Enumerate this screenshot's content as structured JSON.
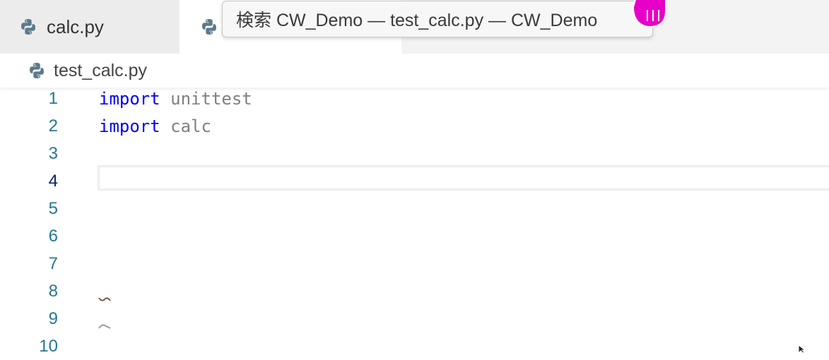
{
  "tabs": [
    {
      "label": "calc.py",
      "icon": "python-icon",
      "active": false
    },
    {
      "label": "test_calc.py",
      "icon": "python-icon",
      "active": true
    }
  ],
  "tooltip": {
    "text": "検索 CW_Demo — test_calc.py — CW_Demo"
  },
  "breadcrumb": {
    "file": "test_calc.py",
    "icon": "python-icon"
  },
  "editor": {
    "current_line": 4,
    "lines": [
      {
        "num": "1",
        "keyword": "import",
        "module": "unittest"
      },
      {
        "num": "2",
        "keyword": "import",
        "module": "calc"
      },
      {
        "num": "3"
      },
      {
        "num": "4"
      },
      {
        "num": "5"
      },
      {
        "num": "6"
      },
      {
        "num": "7"
      },
      {
        "num": "8"
      },
      {
        "num": "9"
      },
      {
        "num": "10"
      }
    ]
  },
  "colors": {
    "keyword": "#0000ff",
    "module": "#808080",
    "line_number": "#237893",
    "active_line_number": "#0b216f",
    "cursor_highlight": "#e600c8"
  }
}
